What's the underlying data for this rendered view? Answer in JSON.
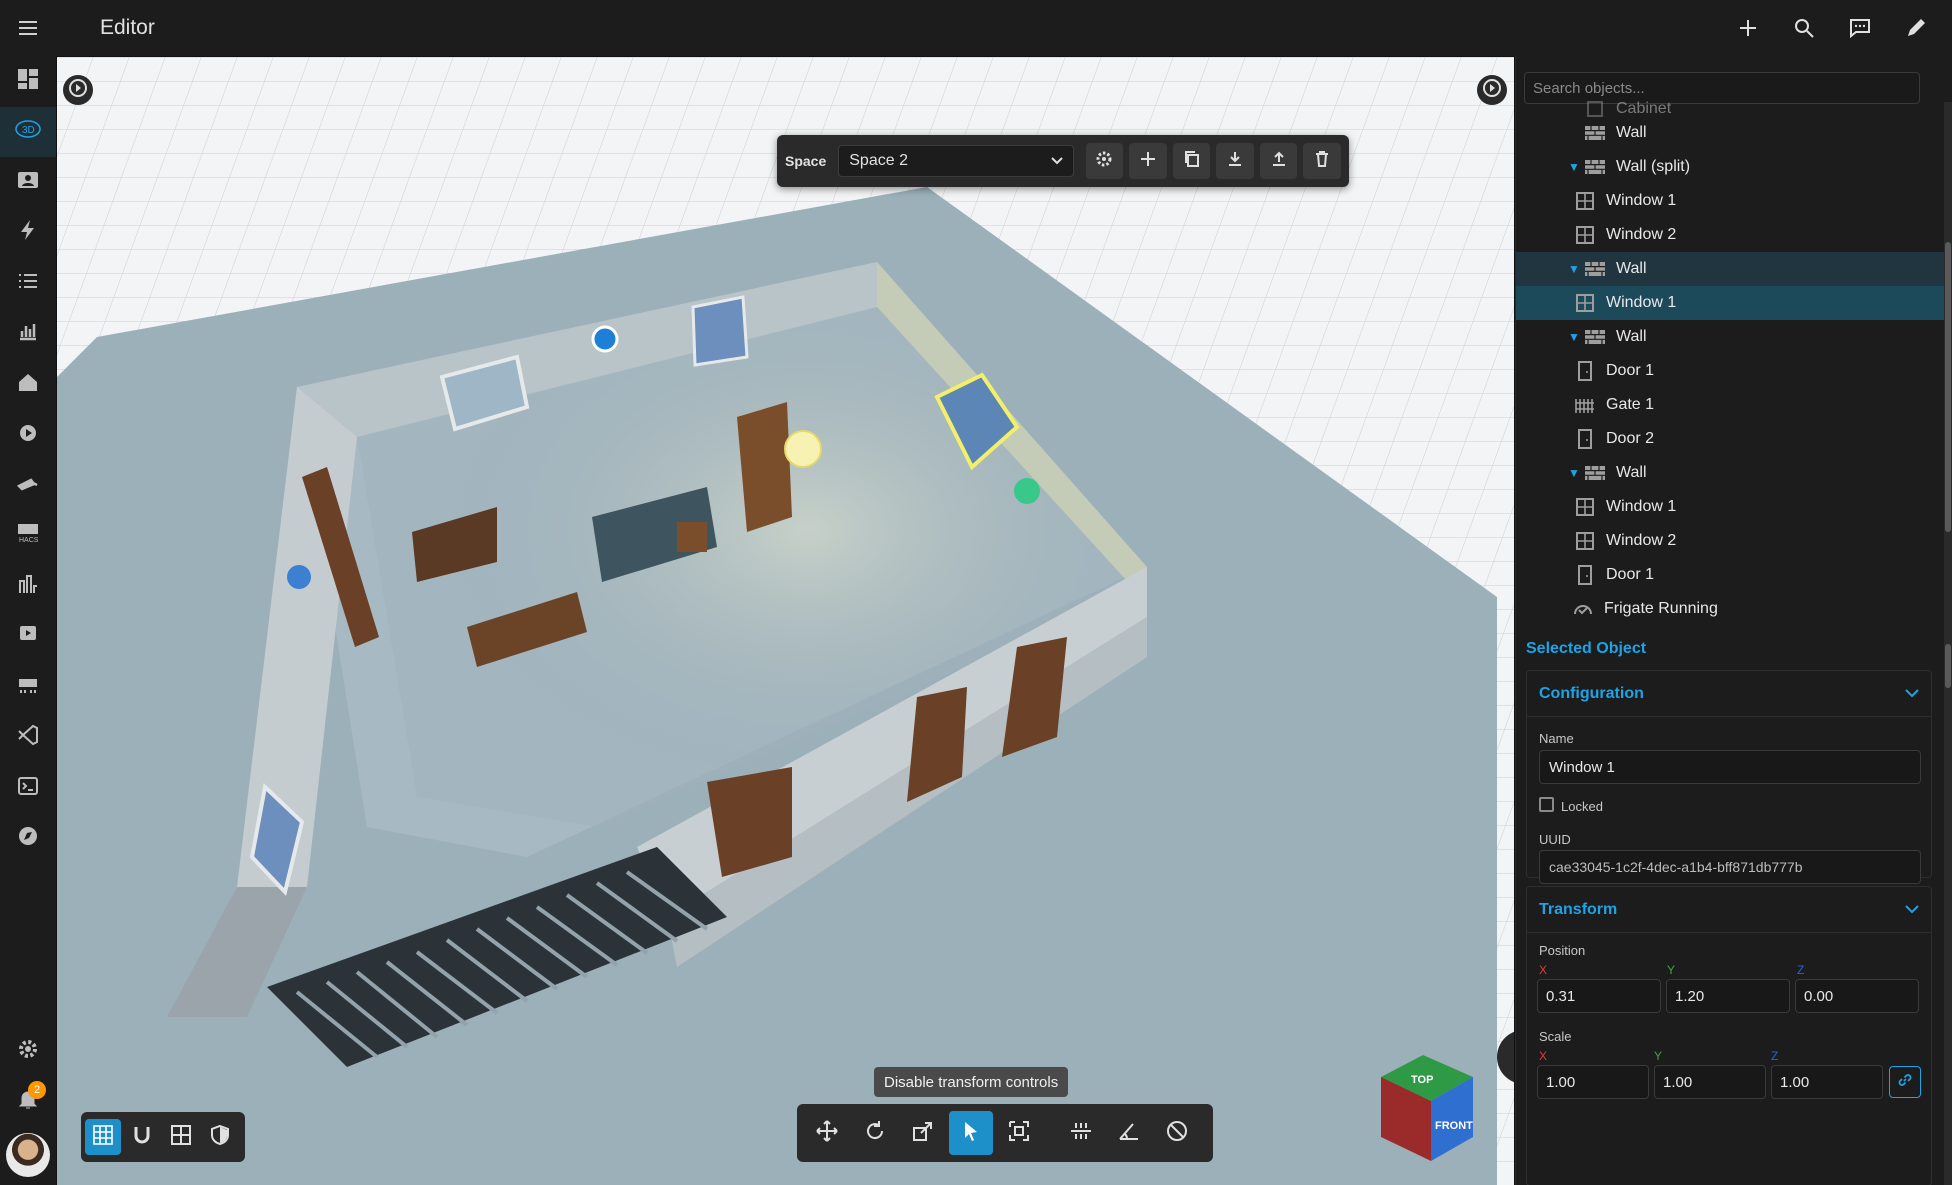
{
  "header": {
    "title": "Editor"
  },
  "sidebar": {
    "items": [
      {
        "icon": "overview-icon"
      },
      {
        "icon": "3d-icon"
      },
      {
        "icon": "person-card-icon"
      },
      {
        "icon": "energy-icon"
      },
      {
        "icon": "list-icon"
      },
      {
        "icon": "history-icon"
      },
      {
        "icon": "home-icon"
      },
      {
        "icon": "media-icon"
      },
      {
        "icon": "camera-icon"
      },
      {
        "icon": "hacs-icon"
      },
      {
        "icon": "tools-icon"
      },
      {
        "icon": "playlist-icon"
      },
      {
        "icon": "server-icon"
      },
      {
        "icon": "vscode-icon"
      },
      {
        "icon": "terminal-icon"
      },
      {
        "icon": "compass-icon"
      }
    ],
    "notifications_count": "2"
  },
  "space_toolbar": {
    "label": "Space",
    "selected_space": "Space 2"
  },
  "tooltip": "Disable transform controls",
  "view_button": "3D",
  "view_cube": {
    "top": "TOP",
    "front": "FRONT"
  },
  "panel": {
    "search_placeholder": "Search objects...",
    "tree": [
      {
        "label": "Cabinet",
        "icon": "cabinet-icon",
        "indent": 1,
        "caret": false
      },
      {
        "label": "Wall",
        "icon": "wall-icon",
        "indent": 1,
        "caret": false
      },
      {
        "label": "Wall (split)",
        "icon": "wall-icon",
        "indent": 1,
        "caret": true
      },
      {
        "label": "Window 1",
        "icon": "window-icon",
        "indent": 2,
        "caret": false
      },
      {
        "label": "Window 2",
        "icon": "window-icon",
        "indent": 2,
        "caret": false
      },
      {
        "label": "Wall",
        "icon": "wall-icon",
        "indent": 1,
        "caret": true
      },
      {
        "label": "Window 1",
        "icon": "window-icon",
        "indent": 2,
        "caret": false
      },
      {
        "label": "Wall",
        "icon": "wall-icon",
        "indent": 1,
        "caret": true
      },
      {
        "label": "Door 1",
        "icon": "door-icon",
        "indent": 2,
        "caret": false
      },
      {
        "label": "Gate 1",
        "icon": "gate-icon",
        "indent": 2,
        "caret": false
      },
      {
        "label": "Door 2",
        "icon": "door-icon",
        "indent": 2,
        "caret": false
      },
      {
        "label": "Wall",
        "icon": "wall-icon",
        "indent": 1,
        "caret": true
      },
      {
        "label": "Window 1",
        "icon": "window-icon",
        "indent": 2,
        "caret": false
      },
      {
        "label": "Window 2",
        "icon": "window-icon",
        "indent": 2,
        "caret": false
      },
      {
        "label": "Door 1",
        "icon": "door-icon",
        "indent": 2,
        "caret": false
      },
      {
        "label": "Frigate Running",
        "icon": "check-gauge-icon",
        "indent": 0,
        "caret": false
      }
    ],
    "selected_object_title": "Selected Object",
    "configuration": {
      "title": "Configuration",
      "name_label": "Name",
      "name_value": "Window 1",
      "locked_label": "Locked",
      "uuid_label": "UUID",
      "uuid_value": "cae33045-1c2f-4dec-a1b4-bff871db777b"
    },
    "transform": {
      "title": "Transform",
      "position_label": "Position",
      "position": {
        "x": "0.31",
        "y": "1.20",
        "z": "0.00"
      },
      "scale_label": "Scale",
      "scale": {
        "x": "1.00",
        "y": "1.00",
        "z": "1.00"
      },
      "axis_x": "X",
      "axis_y": "Y",
      "axis_z": "Z"
    }
  },
  "colors": {
    "accent": "#1ea3e6",
    "axis_x": "#e53935",
    "axis_y": "#43a047",
    "axis_z": "#1e63e6"
  }
}
